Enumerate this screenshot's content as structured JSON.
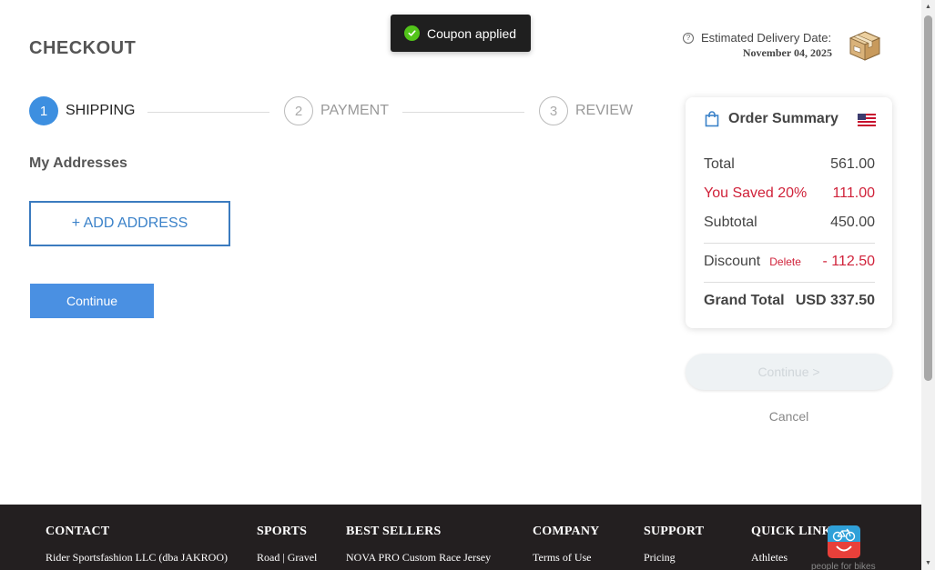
{
  "header": {
    "title": "CHECKOUT",
    "delivery_label": "Estimated Delivery Date:",
    "delivery_date": "November 04, 2025"
  },
  "toast": {
    "message": "Coupon applied"
  },
  "steps": [
    {
      "number": "1",
      "label": "SHIPPING",
      "active": true
    },
    {
      "number": "2",
      "label": "PAYMENT",
      "active": false
    },
    {
      "number": "3",
      "label": "REVIEW",
      "active": false
    }
  ],
  "addresses": {
    "heading": "My Addresses",
    "add_label": "+ ADD ADDRESS",
    "continue_label": "Continue"
  },
  "summary": {
    "title": "Order Summary",
    "total_label": "Total",
    "total_value": "561.00",
    "saved_label": "You Saved 20%",
    "saved_value": "111.00",
    "subtotal_label": "Subtotal",
    "subtotal_value": "450.00",
    "discount_label": "Discount",
    "discount_delete": "Delete",
    "discount_value": "- 112.50",
    "grand_label": "Grand Total",
    "grand_value": "USD 337.50",
    "continue_label": "Continue >",
    "cancel_label": "Cancel"
  },
  "footer": {
    "columns": [
      {
        "heading": "CONTACT",
        "item": "Rider Sportsfashion LLC (dba JAKROO)"
      },
      {
        "heading": "SPORTS",
        "item": "Road | Gravel"
      },
      {
        "heading": "BEST SELLERS",
        "item": "NOVA PRO Custom Race Jersey"
      },
      {
        "heading": "COMPANY",
        "item": "Terms of Use"
      },
      {
        "heading": "SUPPORT",
        "item": "Pricing"
      },
      {
        "heading": "QUICK LINKS",
        "item": "Athletes"
      }
    ],
    "badge_text": "people for bikes"
  },
  "colors": {
    "accent": "#3d8fe0",
    "danger": "#d0223a",
    "toast_bg": "#1f1f1f",
    "success": "#52c41a",
    "footer_bg": "#231f20"
  }
}
